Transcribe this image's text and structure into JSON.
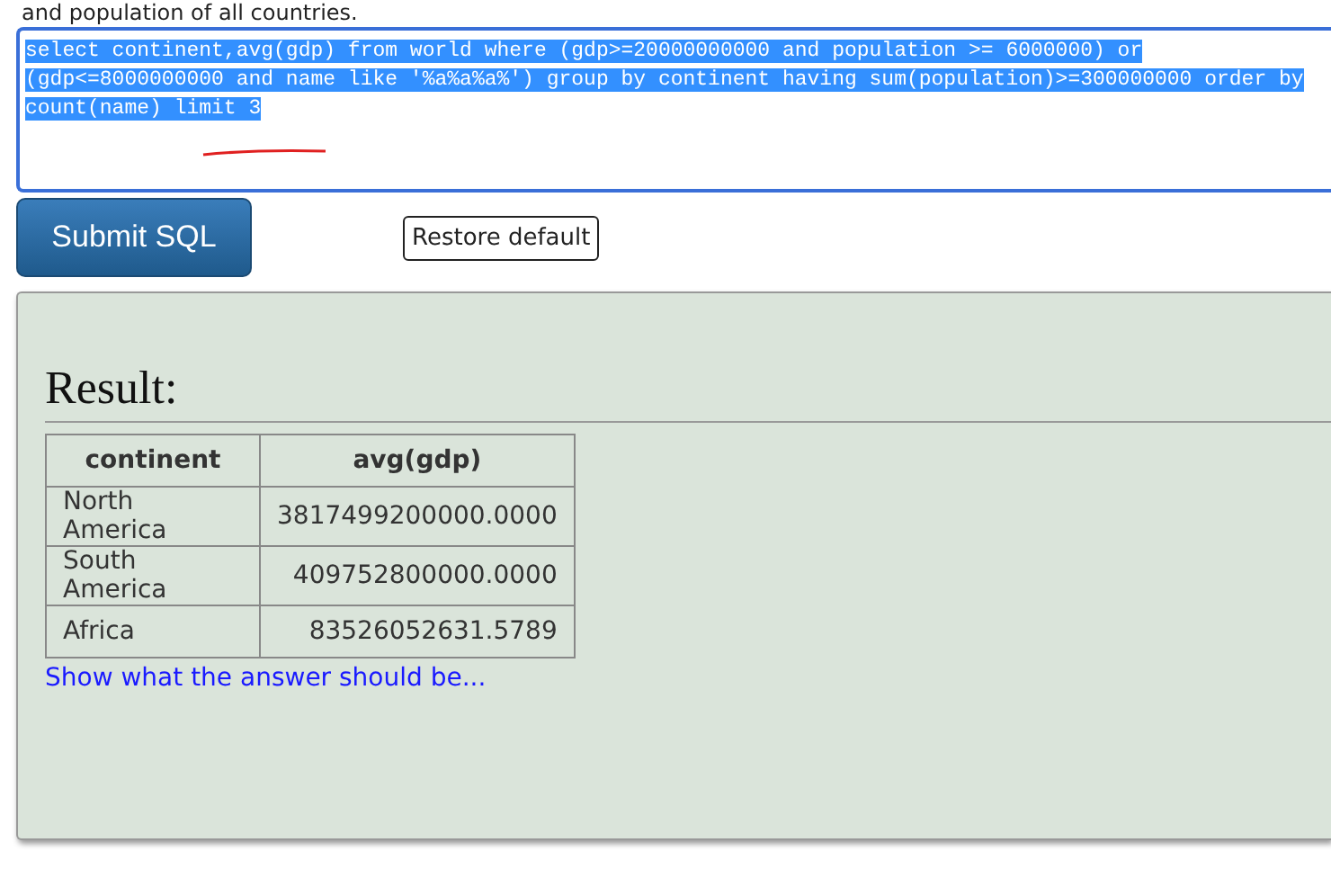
{
  "intro_text": "and population of all countries.",
  "sql_editor": {
    "value": "select continent,avg(gdp) from world where (gdp>=20000000000 and population >= 6000000) or (gdp<=8000000000 and name like '%a%a%a%') group by continent having sum(population)>=300000000 order by count(name) limit 3",
    "selected": true
  },
  "buttons": {
    "submit": "Submit SQL",
    "restore": "Restore default"
  },
  "result": {
    "heading": "Result:",
    "table": {
      "columns": [
        "continent",
        "avg(gdp)"
      ],
      "rows": [
        [
          "North America",
          "3817499200000.0000"
        ],
        [
          "South America",
          "409752800000.0000"
        ],
        [
          "Africa",
          "83526052631.5789"
        ]
      ]
    },
    "answer_link": "Show what the answer should be..."
  }
}
